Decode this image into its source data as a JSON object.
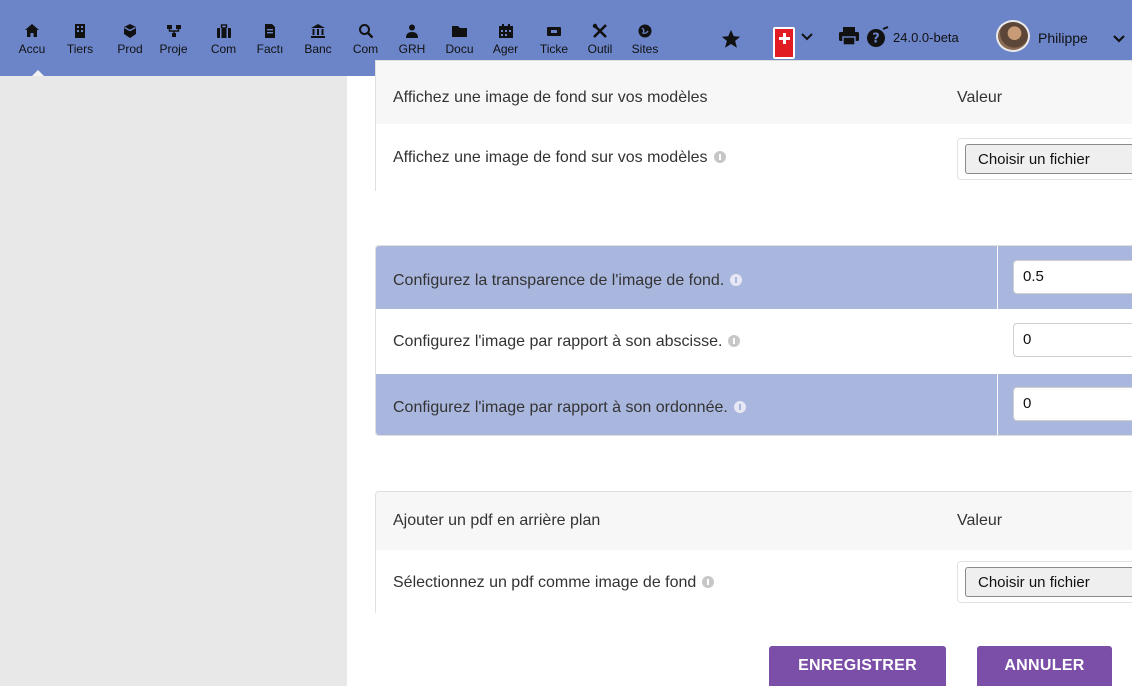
{
  "menu": [
    {
      "icon": "home-icon",
      "glyph": "🏠",
      "label": "Accu"
    },
    {
      "icon": "building-icon",
      "glyph": "▦",
      "label": "Tiers"
    },
    {
      "icon": "cube-icon",
      "glyph": "⬢",
      "label": "Prod"
    },
    {
      "icon": "project-icon",
      "glyph": "⚘",
      "label": "Proje"
    },
    {
      "icon": "suitcase-icon",
      "glyph": "▮",
      "label": "Com"
    },
    {
      "icon": "invoice-icon",
      "glyph": "▯",
      "label": "Factı"
    },
    {
      "icon": "bank-icon",
      "glyph": "🏛",
      "label": "Banc"
    },
    {
      "icon": "magnifier-icon",
      "glyph": "🔍",
      "label": "Com"
    },
    {
      "icon": "people-icon",
      "glyph": "👥",
      "label": "GRH"
    },
    {
      "icon": "folder-icon",
      "glyph": "📂",
      "label": "Docu"
    },
    {
      "icon": "calendar-icon",
      "glyph": "▤",
      "label": "Ager"
    },
    {
      "icon": "ticket-icon",
      "glyph": "▬",
      "label": "Ticke"
    },
    {
      "icon": "tools-icon",
      "glyph": "✕",
      "label": "Outil"
    },
    {
      "icon": "globe-icon",
      "glyph": "⊕",
      "label": "Sites"
    }
  ],
  "topright": {
    "version": "24.0.0-beta",
    "username": "Philippe"
  },
  "section1": {
    "header": "Affichez une image de fond sur vos modèles",
    "value_header": "Valeur",
    "row_label": "Affichez une image de fond sur vos modèles",
    "button": "Choisir un fichier"
  },
  "section2": {
    "rows": [
      {
        "label": "Configurez la transparence de l'image de fond.",
        "value": "0.5"
      },
      {
        "label": "Configurez l'image par rapport à son abscisse.",
        "value": "0"
      },
      {
        "label": "Configurez l'image par rapport à son ordonnée.",
        "value": "0"
      }
    ]
  },
  "section3": {
    "header": "Ajouter un pdf en arrière plan",
    "value_header": "Valeur",
    "row_label": "Sélectionnez un pdf comme image de fond",
    "button": "Choisir un fichier"
  },
  "actions": {
    "save": "ENREGISTRER",
    "cancel": "ANNULER"
  }
}
